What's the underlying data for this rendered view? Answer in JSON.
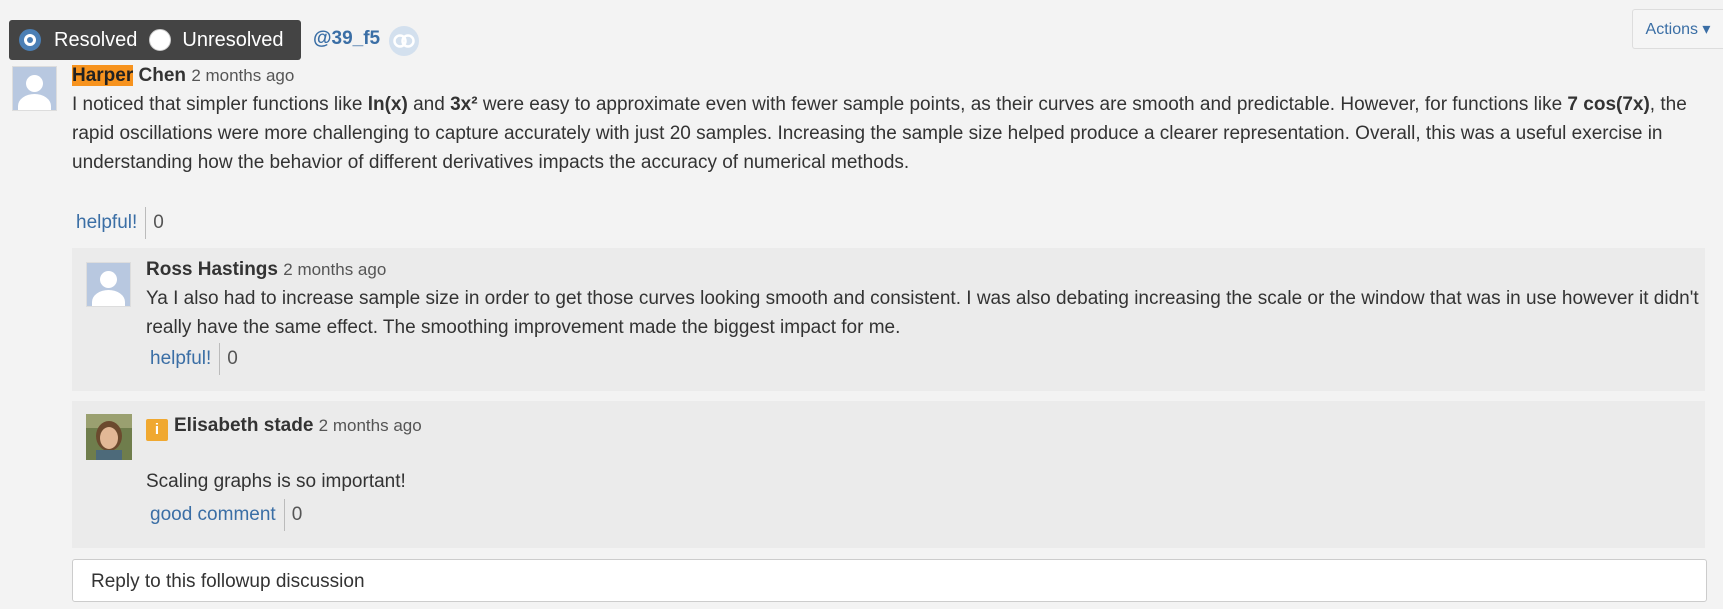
{
  "resolve": {
    "resolved_label": "Resolved",
    "unresolved_label": "Unresolved",
    "selected": "Resolved"
  },
  "post_id": "@39_f5",
  "actions_label": "Actions ▾",
  "main_post": {
    "author_first": "Harper",
    "author_last": "Chen",
    "time": "2 months ago",
    "text_parts": {
      "p1": "I noticed that simpler functions like ",
      "b1": "ln(x)",
      "p2": " and ",
      "b2": "3x²",
      "p3": " were easy to approximate even with fewer sample points, as their curves are smooth and predictable. However, for functions like ",
      "b3": "7 cos(7x)",
      "p4": ", the rapid oscillations were more challenging to capture accurately with just 20 samples. Increasing the sample size helped produce a clearer representation. Overall, this was a useful exercise in understanding how the behavior of different derivatives impacts the accuracy of numerical methods."
    },
    "helpful_label": "helpful!",
    "helpful_count": "0"
  },
  "replies": [
    {
      "author": "Ross Hastings",
      "time": "2 months ago",
      "text": "Ya I also had to increase sample size in order to get those curves looking smooth and consistent.  I was also debating increasing the scale or the window that was in use however it didn't really have the same effect.  The smoothing improvement made the biggest impact for me.",
      "helpful_label": "helpful!",
      "helpful_count": "0"
    },
    {
      "badge": "i",
      "author": "Elisabeth stade",
      "time": "2 months ago",
      "text": "Scaling graphs is so important!",
      "helpful_label": "good comment",
      "helpful_count": "0"
    }
  ],
  "reply_placeholder": "Reply to this followup discussion",
  "colors": {
    "accent": "#3a6ea5",
    "highlight": "#f7931e",
    "resolve_bar": "#444444",
    "instructor_badge": "#f0a830"
  }
}
